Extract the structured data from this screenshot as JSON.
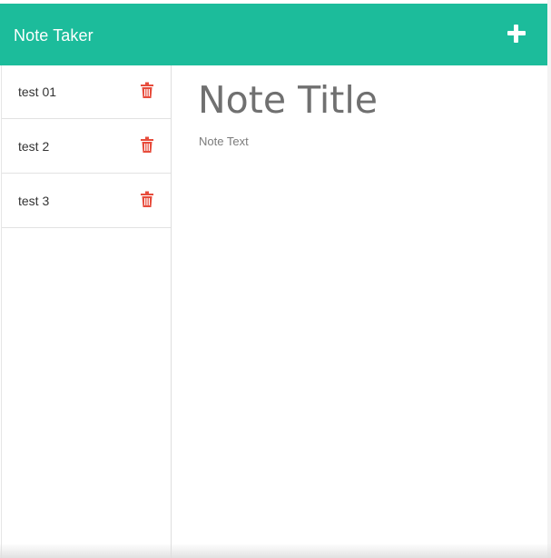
{
  "header": {
    "brand": "Note Taker",
    "new_note_icon": "plus-icon",
    "background_color": "#1cbc9b"
  },
  "sidebar": {
    "notes": [
      {
        "title": "test 01",
        "delete_icon": "trash-icon"
      },
      {
        "title": "test 2",
        "delete_icon": "trash-icon"
      },
      {
        "title": "test 3",
        "delete_icon": "trash-icon"
      }
    ],
    "delete_color": "#e74c3c"
  },
  "editor": {
    "title_placeholder": "Note Title",
    "text_placeholder": "Note Text",
    "title_value": "",
    "text_value": ""
  }
}
